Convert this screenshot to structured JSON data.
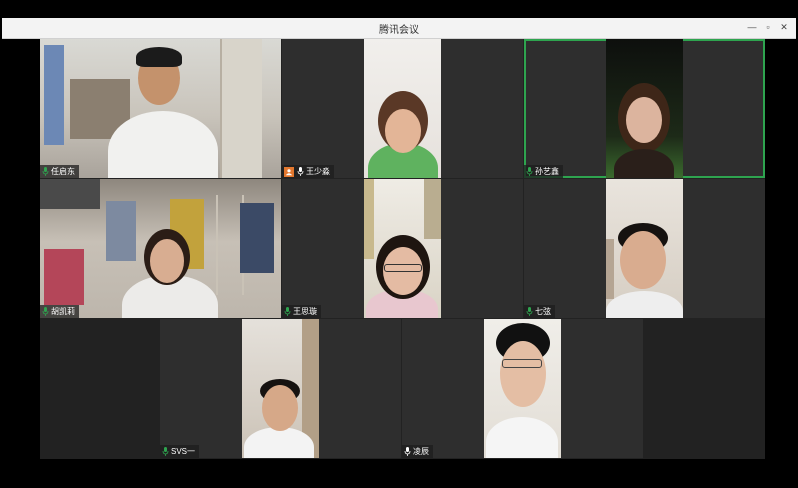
{
  "window": {
    "title": "腾讯会议",
    "minimize": "—",
    "maximize": "▫",
    "close": "✕"
  },
  "participants": [
    {
      "name": "任启东",
      "host": false,
      "active": false
    },
    {
      "name": "王少淼",
      "host": true,
      "active": false
    },
    {
      "name": "孙艺鑫",
      "host": false,
      "active": true
    },
    {
      "name": "胡凯莉",
      "host": false,
      "active": false
    },
    {
      "name": "王思璇",
      "host": false,
      "active": false
    },
    {
      "name": "七弦",
      "host": false,
      "active": false
    },
    {
      "name": "SVS一",
      "host": false,
      "active": false
    },
    {
      "name": "凌辰",
      "host": false,
      "active": false
    }
  ],
  "colors": {
    "background": "#000000",
    "tile": "#2e2e2e",
    "active_border": "#2ea44f",
    "mic": "#2ea44f",
    "host_badge": "#e2772e"
  }
}
